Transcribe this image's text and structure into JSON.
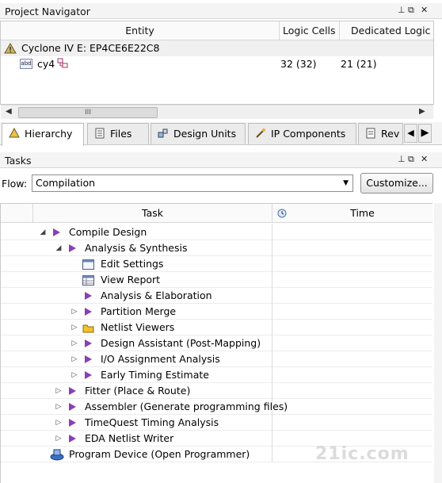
{
  "project_navigator": {
    "title": "Project Navigator",
    "columns": [
      "Entity",
      "Logic Cells",
      "Dedicated Logic R"
    ],
    "rows": [
      {
        "entity": "Cyclone IV E: EP4CE6E22C8",
        "logic_cells": "",
        "dedicated": ""
      },
      {
        "entity": "cy4",
        "logic_cells": "32 (32)",
        "dedicated": "21 (21)"
      }
    ],
    "scroll_thumb": "III"
  },
  "tabs": [
    {
      "label": "Hierarchy",
      "icon": "hierarchy-warning-icon",
      "active": true
    },
    {
      "label": "Files",
      "icon": "file-icon",
      "active": false
    },
    {
      "label": "Design Units",
      "icon": "design-units-icon",
      "active": false
    },
    {
      "label": "IP Components",
      "icon": "ip-components-icon",
      "active": false
    },
    {
      "label": "Rev",
      "icon": "revisions-icon",
      "active": false
    }
  ],
  "tasks_pane": {
    "title": "Tasks",
    "flow_label": "Flow:",
    "flow_value": "Compilation",
    "customize_label": "Customize...",
    "columns": [
      "Task",
      "Time"
    ],
    "items": [
      {
        "label": "Compile Design",
        "level": 0,
        "expander": "expanded",
        "icon": "play"
      },
      {
        "label": "Analysis & Synthesis",
        "level": 1,
        "expander": "expanded",
        "icon": "play"
      },
      {
        "label": "Edit Settings",
        "level": 2,
        "expander": "none",
        "icon": "settings"
      },
      {
        "label": "View Report",
        "level": 2,
        "expander": "none",
        "icon": "report"
      },
      {
        "label": "Analysis & Elaboration",
        "level": 2,
        "expander": "none",
        "icon": "play"
      },
      {
        "label": "Partition Merge",
        "level": 2,
        "expander": "collapsed",
        "icon": "play"
      },
      {
        "label": "Netlist Viewers",
        "level": 2,
        "expander": "collapsed",
        "icon": "folder"
      },
      {
        "label": "Design Assistant (Post-Mapping)",
        "level": 2,
        "expander": "collapsed",
        "icon": "play"
      },
      {
        "label": "I/O Assignment Analysis",
        "level": 2,
        "expander": "collapsed",
        "icon": "play"
      },
      {
        "label": "Early Timing Estimate",
        "level": 2,
        "expander": "collapsed",
        "icon": "play"
      },
      {
        "label": "Fitter (Place & Route)",
        "level": 1,
        "expander": "collapsed",
        "icon": "play"
      },
      {
        "label": "Assembler (Generate programming files)",
        "level": 1,
        "expander": "collapsed",
        "icon": "play"
      },
      {
        "label": "TimeQuest Timing Analysis",
        "level": 1,
        "expander": "collapsed",
        "icon": "play"
      },
      {
        "label": "EDA Netlist Writer",
        "level": 1,
        "expander": "collapsed",
        "icon": "play"
      },
      {
        "label": "Program Device (Open Programmer)",
        "level": 0,
        "expander": "none",
        "icon": "programmer"
      }
    ]
  },
  "watermark": "21ic.com",
  "colors": {
    "play": "#8a3fb4",
    "folder": "#f2c230",
    "accent": "#3b6fc4"
  }
}
